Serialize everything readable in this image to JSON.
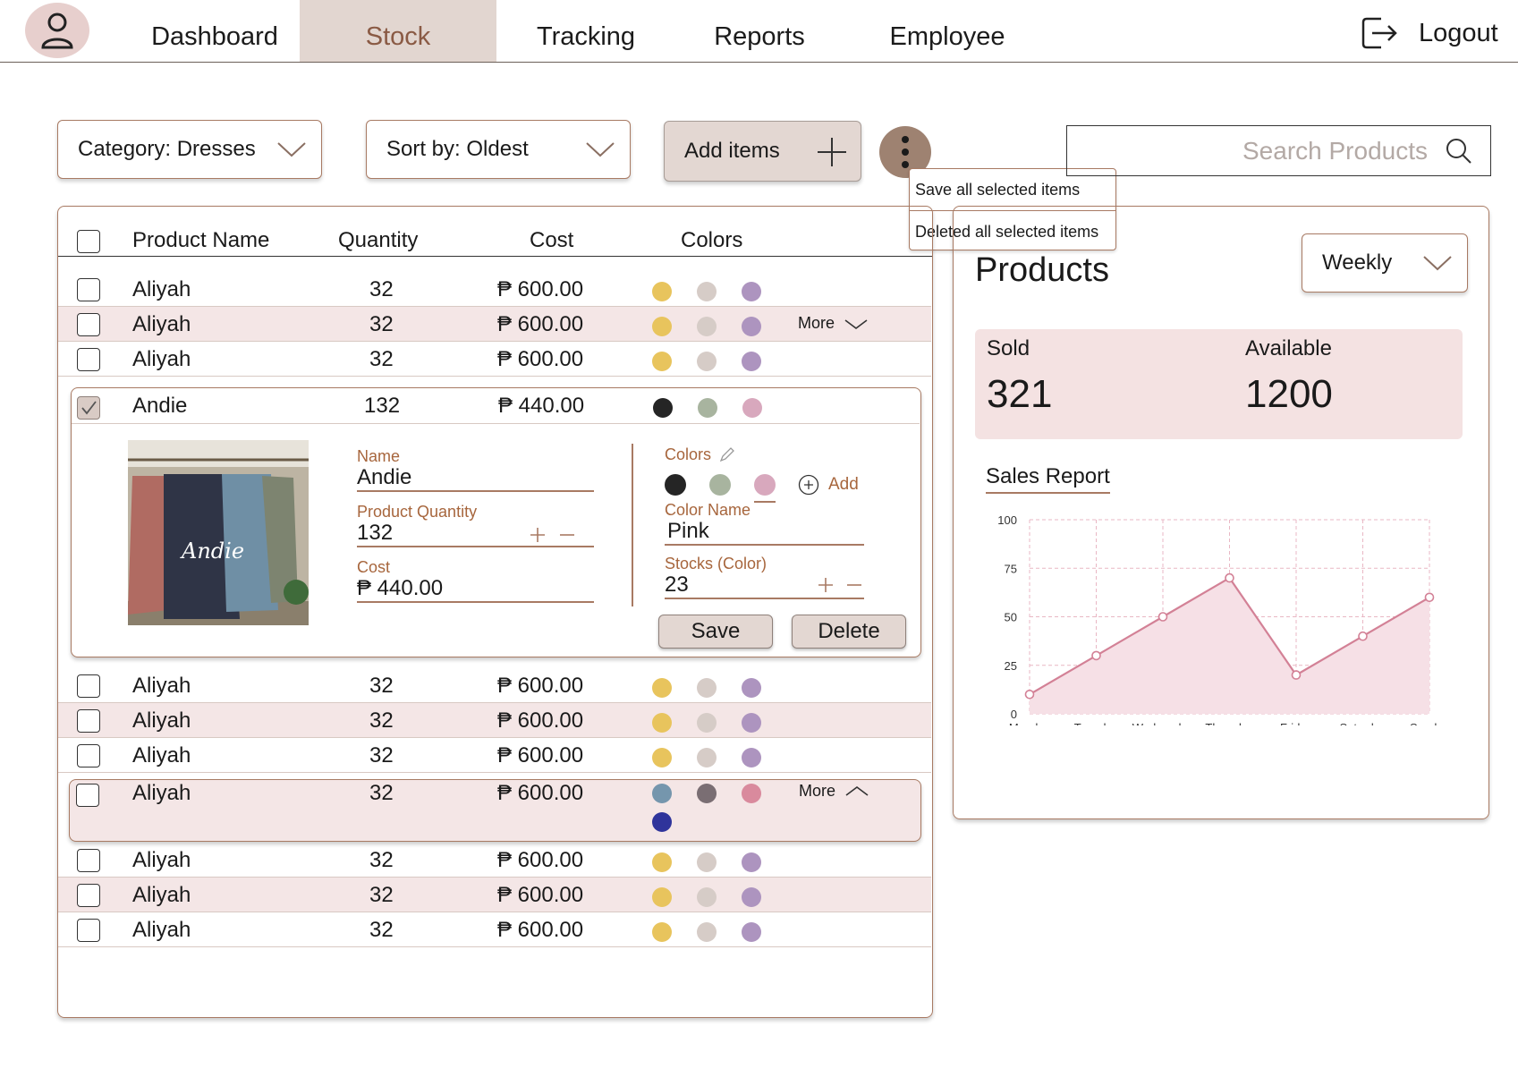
{
  "nav": {
    "items": [
      "Dashboard",
      "Stock",
      "Tracking",
      "Reports",
      "Employee"
    ],
    "active": "Stock",
    "logout_label": "Logout"
  },
  "toolbar": {
    "category_label": "Category: Dresses",
    "sort_label": "Sort by: Oldest",
    "add_label": "Add items",
    "menu": [
      "Save all selected items",
      "Deleted all selected items"
    ],
    "search_placeholder": "Search Products"
  },
  "table": {
    "headers": [
      "Product Name",
      "Quantity",
      "Cost",
      "Colors"
    ],
    "more_label": "More",
    "rows_top": [
      {
        "name": "Aliyah",
        "qty": "32",
        "cost": "₱ 600.00"
      },
      {
        "name": "Aliyah",
        "qty": "32",
        "cost": "₱ 600.00"
      },
      {
        "name": "Aliyah",
        "qty": "32",
        "cost": "₱ 600.00"
      }
    ],
    "expanded": {
      "name": "Andie",
      "qty": "132",
      "cost": "₱ 440.00",
      "image_caption": "Andie",
      "form": {
        "name_label": "Name",
        "name_value": "Andie",
        "qty_label": "Product Quantity",
        "qty_value": "132",
        "cost_label": "Cost",
        "cost_value": "₱ 440.00",
        "colors_label": "Colors",
        "add_label": "Add",
        "color_name_label": "Color Name",
        "color_name_value": "Pink",
        "stock_label": "Stocks (Color)",
        "stock_value": "23",
        "save_label": "Save",
        "delete_label": "Delete"
      }
    },
    "rows_mid": [
      {
        "name": "Aliyah",
        "qty": "32",
        "cost": "₱ 600.00"
      },
      {
        "name": "Aliyah",
        "qty": "32",
        "cost": "₱ 600.00"
      },
      {
        "name": "Aliyah",
        "qty": "32",
        "cost": "₱ 600.00"
      }
    ],
    "more_row": {
      "name": "Aliyah",
      "qty": "32",
      "cost": "₱ 600.00"
    },
    "rows_bottom": [
      {
        "name": "Aliyah",
        "qty": "32",
        "cost": "₱ 600.00"
      },
      {
        "name": "Aliyah",
        "qty": "32",
        "cost": "₱ 600.00"
      },
      {
        "name": "Aliyah",
        "qty": "32",
        "cost": "₱ 600.00"
      }
    ]
  },
  "colors": {
    "default": [
      "#e8c45d",
      "#d6ccc7",
      "#ad94bf"
    ],
    "andie": [
      "#252525",
      "#a8b49f",
      "#d8a8bd"
    ],
    "more_row": [
      "#7596ad",
      "#7a6e73",
      "#d98a9d",
      "#2f349b"
    ],
    "accent": "#a87a63",
    "chart_line": "#d38196"
  },
  "products": {
    "title": "Products",
    "period": "Weekly",
    "sold_label": "Sold",
    "sold_value": "321",
    "available_label": "Available",
    "available_value": "1200",
    "sales_report_label": "Sales Report"
  },
  "chart_data": {
    "type": "area",
    "title": "Sales Report",
    "categories": [
      "Monday",
      "Tuesday",
      "Wednesday",
      "Thursday",
      "Friday",
      "Saturday",
      "Sunday"
    ],
    "values": [
      10,
      30,
      50,
      70,
      20,
      40,
      60
    ],
    "yticks": [
      0,
      25,
      50,
      75,
      100
    ],
    "ylim": [
      0,
      100
    ],
    "grid": true
  }
}
